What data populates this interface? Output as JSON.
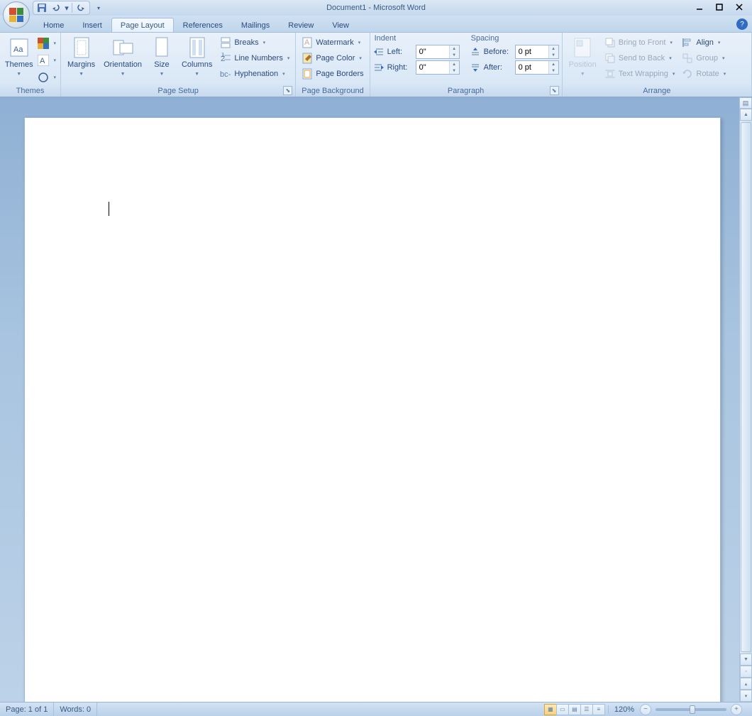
{
  "title": "Document1 - Microsoft Word",
  "tabs": [
    "Home",
    "Insert",
    "Page Layout",
    "References",
    "Mailings",
    "Review",
    "View"
  ],
  "active_tab": 2,
  "ribbon": {
    "themes": {
      "label": "Themes",
      "button": "Themes"
    },
    "page_setup": {
      "label": "Page Setup",
      "margins": "Margins",
      "orientation": "Orientation",
      "size": "Size",
      "columns": "Columns",
      "breaks": "Breaks",
      "line_numbers": "Line Numbers",
      "hyphenation": "Hyphenation"
    },
    "page_background": {
      "label": "Page Background",
      "watermark": "Watermark",
      "page_color": "Page Color",
      "page_borders": "Page Borders"
    },
    "paragraph": {
      "label": "Paragraph",
      "indent": "Indent",
      "spacing": "Spacing",
      "left": "Left:",
      "right": "Right:",
      "before": "Before:",
      "after": "After:",
      "left_val": "0\"",
      "right_val": "0\"",
      "before_val": "0 pt",
      "after_val": "0 pt"
    },
    "arrange": {
      "label": "Arrange",
      "position": "Position",
      "bring_front": "Bring to Front",
      "send_back": "Send to Back",
      "text_wrap": "Text Wrapping",
      "align": "Align",
      "group": "Group",
      "rotate": "Rotate"
    }
  },
  "status": {
    "page": "Page: 1 of 1",
    "words": "Words: 0",
    "zoom": "120%"
  }
}
